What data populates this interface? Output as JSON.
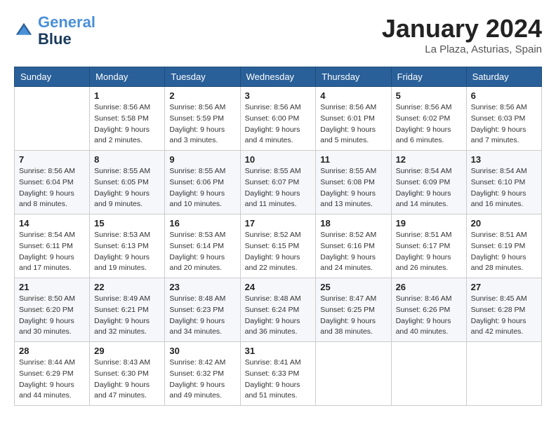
{
  "header": {
    "logo_line1": "General",
    "logo_line2": "Blue",
    "month_title": "January 2024",
    "location": "La Plaza, Asturias, Spain"
  },
  "days_of_week": [
    "Sunday",
    "Monday",
    "Tuesday",
    "Wednesday",
    "Thursday",
    "Friday",
    "Saturday"
  ],
  "weeks": [
    [
      {
        "day": "",
        "sunrise": "",
        "sunset": "",
        "daylight": ""
      },
      {
        "day": "1",
        "sunrise": "Sunrise: 8:56 AM",
        "sunset": "Sunset: 5:58 PM",
        "daylight": "Daylight: 9 hours and 2 minutes."
      },
      {
        "day": "2",
        "sunrise": "Sunrise: 8:56 AM",
        "sunset": "Sunset: 5:59 PM",
        "daylight": "Daylight: 9 hours and 3 minutes."
      },
      {
        "day": "3",
        "sunrise": "Sunrise: 8:56 AM",
        "sunset": "Sunset: 6:00 PM",
        "daylight": "Daylight: 9 hours and 4 minutes."
      },
      {
        "day": "4",
        "sunrise": "Sunrise: 8:56 AM",
        "sunset": "Sunset: 6:01 PM",
        "daylight": "Daylight: 9 hours and 5 minutes."
      },
      {
        "day": "5",
        "sunrise": "Sunrise: 8:56 AM",
        "sunset": "Sunset: 6:02 PM",
        "daylight": "Daylight: 9 hours and 6 minutes."
      },
      {
        "day": "6",
        "sunrise": "Sunrise: 8:56 AM",
        "sunset": "Sunset: 6:03 PM",
        "daylight": "Daylight: 9 hours and 7 minutes."
      }
    ],
    [
      {
        "day": "7",
        "sunrise": "Sunrise: 8:56 AM",
        "sunset": "Sunset: 6:04 PM",
        "daylight": "Daylight: 9 hours and 8 minutes."
      },
      {
        "day": "8",
        "sunrise": "Sunrise: 8:55 AM",
        "sunset": "Sunset: 6:05 PM",
        "daylight": "Daylight: 9 hours and 9 minutes."
      },
      {
        "day": "9",
        "sunrise": "Sunrise: 8:55 AM",
        "sunset": "Sunset: 6:06 PM",
        "daylight": "Daylight: 9 hours and 10 minutes."
      },
      {
        "day": "10",
        "sunrise": "Sunrise: 8:55 AM",
        "sunset": "Sunset: 6:07 PM",
        "daylight": "Daylight: 9 hours and 11 minutes."
      },
      {
        "day": "11",
        "sunrise": "Sunrise: 8:55 AM",
        "sunset": "Sunset: 6:08 PM",
        "daylight": "Daylight: 9 hours and 13 minutes."
      },
      {
        "day": "12",
        "sunrise": "Sunrise: 8:54 AM",
        "sunset": "Sunset: 6:09 PM",
        "daylight": "Daylight: 9 hours and 14 minutes."
      },
      {
        "day": "13",
        "sunrise": "Sunrise: 8:54 AM",
        "sunset": "Sunset: 6:10 PM",
        "daylight": "Daylight: 9 hours and 16 minutes."
      }
    ],
    [
      {
        "day": "14",
        "sunrise": "Sunrise: 8:54 AM",
        "sunset": "Sunset: 6:11 PM",
        "daylight": "Daylight: 9 hours and 17 minutes."
      },
      {
        "day": "15",
        "sunrise": "Sunrise: 8:53 AM",
        "sunset": "Sunset: 6:13 PM",
        "daylight": "Daylight: 9 hours and 19 minutes."
      },
      {
        "day": "16",
        "sunrise": "Sunrise: 8:53 AM",
        "sunset": "Sunset: 6:14 PM",
        "daylight": "Daylight: 9 hours and 20 minutes."
      },
      {
        "day": "17",
        "sunrise": "Sunrise: 8:52 AM",
        "sunset": "Sunset: 6:15 PM",
        "daylight": "Daylight: 9 hours and 22 minutes."
      },
      {
        "day": "18",
        "sunrise": "Sunrise: 8:52 AM",
        "sunset": "Sunset: 6:16 PM",
        "daylight": "Daylight: 9 hours and 24 minutes."
      },
      {
        "day": "19",
        "sunrise": "Sunrise: 8:51 AM",
        "sunset": "Sunset: 6:17 PM",
        "daylight": "Daylight: 9 hours and 26 minutes."
      },
      {
        "day": "20",
        "sunrise": "Sunrise: 8:51 AM",
        "sunset": "Sunset: 6:19 PM",
        "daylight": "Daylight: 9 hours and 28 minutes."
      }
    ],
    [
      {
        "day": "21",
        "sunrise": "Sunrise: 8:50 AM",
        "sunset": "Sunset: 6:20 PM",
        "daylight": "Daylight: 9 hours and 30 minutes."
      },
      {
        "day": "22",
        "sunrise": "Sunrise: 8:49 AM",
        "sunset": "Sunset: 6:21 PM",
        "daylight": "Daylight: 9 hours and 32 minutes."
      },
      {
        "day": "23",
        "sunrise": "Sunrise: 8:48 AM",
        "sunset": "Sunset: 6:23 PM",
        "daylight": "Daylight: 9 hours and 34 minutes."
      },
      {
        "day": "24",
        "sunrise": "Sunrise: 8:48 AM",
        "sunset": "Sunset: 6:24 PM",
        "daylight": "Daylight: 9 hours and 36 minutes."
      },
      {
        "day": "25",
        "sunrise": "Sunrise: 8:47 AM",
        "sunset": "Sunset: 6:25 PM",
        "daylight": "Daylight: 9 hours and 38 minutes."
      },
      {
        "day": "26",
        "sunrise": "Sunrise: 8:46 AM",
        "sunset": "Sunset: 6:26 PM",
        "daylight": "Daylight: 9 hours and 40 minutes."
      },
      {
        "day": "27",
        "sunrise": "Sunrise: 8:45 AM",
        "sunset": "Sunset: 6:28 PM",
        "daylight": "Daylight: 9 hours and 42 minutes."
      }
    ],
    [
      {
        "day": "28",
        "sunrise": "Sunrise: 8:44 AM",
        "sunset": "Sunset: 6:29 PM",
        "daylight": "Daylight: 9 hours and 44 minutes."
      },
      {
        "day": "29",
        "sunrise": "Sunrise: 8:43 AM",
        "sunset": "Sunset: 6:30 PM",
        "daylight": "Daylight: 9 hours and 47 minutes."
      },
      {
        "day": "30",
        "sunrise": "Sunrise: 8:42 AM",
        "sunset": "Sunset: 6:32 PM",
        "daylight": "Daylight: 9 hours and 49 minutes."
      },
      {
        "day": "31",
        "sunrise": "Sunrise: 8:41 AM",
        "sunset": "Sunset: 6:33 PM",
        "daylight": "Daylight: 9 hours and 51 minutes."
      },
      {
        "day": "",
        "sunrise": "",
        "sunset": "",
        "daylight": ""
      },
      {
        "day": "",
        "sunrise": "",
        "sunset": "",
        "daylight": ""
      },
      {
        "day": "",
        "sunrise": "",
        "sunset": "",
        "daylight": ""
      }
    ]
  ]
}
